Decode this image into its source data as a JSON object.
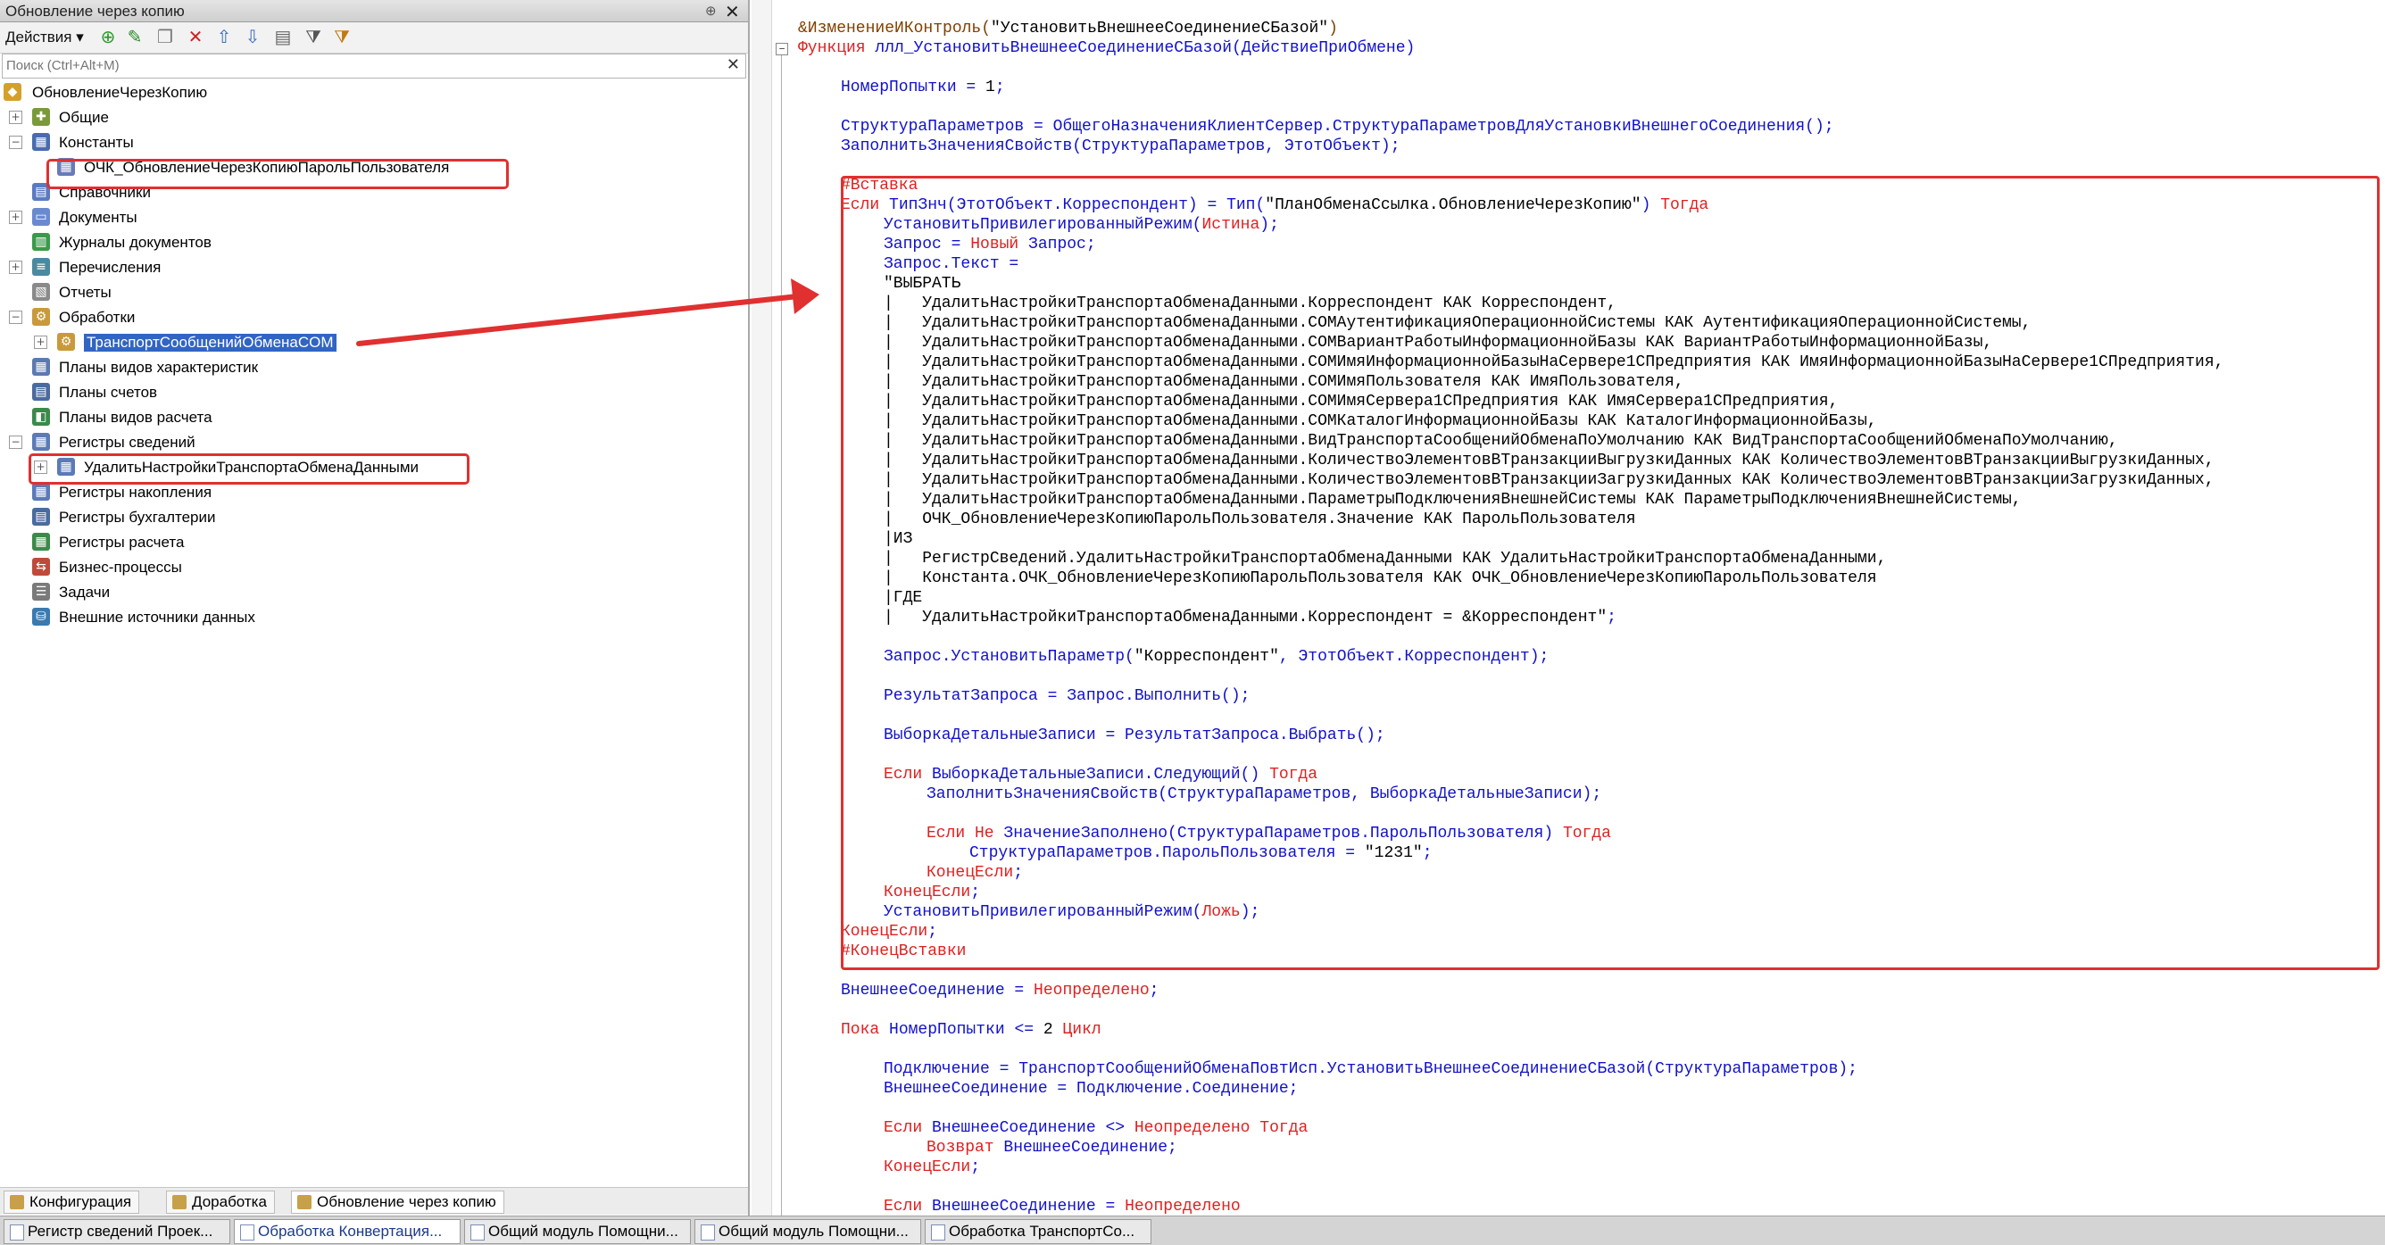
{
  "left_panel": {
    "title": "Обновление через копию",
    "pin": "⊕",
    "close": "✕",
    "actions_label": "Действия ▾",
    "search_placeholder": "Поиск (Ctrl+Alt+M)",
    "tree": [
      {
        "label": "ОбновлениеЧерезКопию",
        "level": 0,
        "icon": "config-icon",
        "expander": "",
        "color": "#d4a02a"
      },
      {
        "label": "Общие",
        "level": 1,
        "icon": "common-icon",
        "expander": "+",
        "color": "#7a9a3a"
      },
      {
        "label": "Константы",
        "level": 1,
        "icon": "constants-icon",
        "expander": "−",
        "color": "#4a6ab0"
      },
      {
        "label": "ОЧК_ОбновлениеЧерезКопиюПарольПользователя",
        "level": 2,
        "icon": "constant-icon",
        "expander": "",
        "color": "#6a7ab8",
        "highlight": true
      },
      {
        "label": "Справочники",
        "level": 1,
        "icon": "catalogs-icon",
        "expander": "",
        "color": "#5a7ac0"
      },
      {
        "label": "Документы",
        "level": 1,
        "icon": "documents-icon",
        "expander": "+",
        "color": "#6a8ad0"
      },
      {
        "label": "Журналы документов",
        "level": 1,
        "icon": "journals-icon",
        "expander": "",
        "color": "#3a9a4a"
      },
      {
        "label": "Перечисления",
        "level": 1,
        "icon": "enums-icon",
        "expander": "+",
        "color": "#4a8aa0"
      },
      {
        "label": "Отчеты",
        "level": 1,
        "icon": "reports-icon",
        "expander": "",
        "color": "#8a8a8a"
      },
      {
        "label": "Обработки",
        "level": 1,
        "icon": "dataprocessors-icon",
        "expander": "−",
        "color": "#c89a3a"
      },
      {
        "label": "ТранспортСообщенийОбменаCOM",
        "level": 2,
        "icon": "dataprocessor-icon",
        "expander": "+",
        "color": "#c89a3a",
        "selected": true
      },
      {
        "label": "Планы видов характеристик",
        "level": 1,
        "icon": "chartofchar-icon",
        "expander": "",
        "color": "#5a7ab0"
      },
      {
        "label": "Планы счетов",
        "level": 1,
        "icon": "chartofaccounts-icon",
        "expander": "",
        "color": "#4a6aa0"
      },
      {
        "label": "Планы видов расчета",
        "level": 1,
        "icon": "chartofcalc-icon",
        "expander": "",
        "color": "#3a8a4a"
      },
      {
        "label": "Регистры сведений",
        "level": 1,
        "icon": "inforegisters-icon",
        "expander": "−",
        "color": "#5a7ab8"
      },
      {
        "label": "УдалитьНастройкиТранспортаОбменаДанными",
        "level": 2,
        "icon": "inforegister-icon",
        "expander": "+",
        "color": "#5a7ab8",
        "highlight": true
      },
      {
        "label": "Регистры накопления",
        "level": 1,
        "icon": "accumregisters-icon",
        "expander": "",
        "color": "#5a7ab8"
      },
      {
        "label": "Регистры бухгалтерии",
        "level": 1,
        "icon": "accountingregisters-icon",
        "expander": "",
        "color": "#4a6aa0"
      },
      {
        "label": "Регистры расчета",
        "level": 1,
        "icon": "calcregisters-icon",
        "expander": "",
        "color": "#3a8a4a"
      },
      {
        "label": "Бизнес-процессы",
        "level": 1,
        "icon": "bizprocess-icon",
        "expander": "",
        "color": "#c04a3a"
      },
      {
        "label": "Задачи",
        "level": 1,
        "icon": "tasks-icon",
        "expander": "",
        "color": "#7a7a7a"
      },
      {
        "label": "Внешние источники данных",
        "level": 1,
        "icon": "extsources-icon",
        "expander": "",
        "color": "#3a7ab0"
      }
    ],
    "tabs": [
      "Конфигурация",
      "Доработка",
      "Обновление через копию"
    ]
  },
  "taskbar": [
    {
      "label": "Регистр сведений Проек...",
      "active": false
    },
    {
      "label": "Обработка Конвертация...",
      "active": true
    },
    {
      "label": "Общий модуль Помощни...",
      "active": false
    },
    {
      "label": "Общий модуль Помощни...",
      "active": false
    },
    {
      "label": "Обработка ТранспортСо...",
      "active": false
    }
  ],
  "code_lines": [
    {
      "indent": 0,
      "html": "<span class='dir'>&amp;ИзменениеИКонтроль(</span><span class='str'>\"УстановитьВнешнееСоединениеСБазой\"</span><span class='dir'>)</span>"
    },
    {
      "indent": 0,
      "html": "<span class='kw'>Функция</span> ллл_УстановитьВнешнееСоединениеСБазой(ДействиеПриОбмене)"
    },
    {
      "indent": 0,
      "html": ""
    },
    {
      "indent": 1,
      "html": "НомерПопытки = <span class='blk'>1</span>;"
    },
    {
      "indent": 0,
      "html": ""
    },
    {
      "indent": 1,
      "html": "СтруктураПараметров = ОбщегоНазначенияКлиентСервер.СтруктураПараметровДляУстановкиВнешнегоСоединения();"
    },
    {
      "indent": 1,
      "html": "ЗаполнитьЗначенияСвойств(СтруктураПараметров, ЭтотОбъект);"
    },
    {
      "indent": 0,
      "html": ""
    },
    {
      "indent": 1,
      "html": "<span class='kw'>#Вставка</span>"
    },
    {
      "indent": 1,
      "html": "<span class='kw'>Если</span> ТипЗнч(ЭтотОбъект.Корреспондент) = Тип(<span class='str'>\"ПланОбменаСсылка.ОбновлениеЧерезКопию\"</span>) <span class='kw'>Тогда</span>"
    },
    {
      "indent": 2,
      "html": "УстановитьПривилегированныйРежим(<span class='kw'>Истина</span>);"
    },
    {
      "indent": 2,
      "html": "Запрос = <span class='kw'>Новый</span> Запрос;"
    },
    {
      "indent": 2,
      "html": "Запрос.Текст ="
    },
    {
      "indent": 2,
      "html": "<span class='str'>\"ВЫБРАТЬ</span>"
    },
    {
      "indent": 2,
      "html": "<span class='str'>|   УдалитьНастройкиТранспортаОбменаДанными.Корреспондент КАК Корреспондент,</span>"
    },
    {
      "indent": 2,
      "html": "<span class='str'>|   УдалитьНастройкиТранспортаОбменаДанными.COMАутентификацияОперационнойСистемы КАК АутентификацияОперационнойСистемы,</span>"
    },
    {
      "indent": 2,
      "html": "<span class='str'>|   УдалитьНастройкиТранспортаОбменаДанными.COMВариантРаботыИнформационнойБазы КАК ВариантРаботыИнформационнойБазы,</span>"
    },
    {
      "indent": 2,
      "html": "<span class='str'>|   УдалитьНастройкиТранспортаОбменаДанными.COMИмяИнформационнойБазыНаСервере1СПредприятия КАК ИмяИнформационнойБазыНаСервере1СПредприятия,</span>"
    },
    {
      "indent": 2,
      "html": "<span class='str'>|   УдалитьНастройкиТранспортаОбменаДанными.COMИмяПользователя КАК ИмяПользователя,</span>"
    },
    {
      "indent": 2,
      "html": "<span class='str'>|   УдалитьНастройкиТранспортаОбменаДанными.COMИмяСервера1СПредприятия КАК ИмяСервера1СПредприятия,</span>"
    },
    {
      "indent": 2,
      "html": "<span class='str'>|   УдалитьНастройкиТранспортаОбменаДанными.COMКаталогИнформационнойБазы КАК КаталогИнформационнойБазы,</span>"
    },
    {
      "indent": 2,
      "html": "<span class='str'>|   УдалитьНастройкиТранспортаОбменаДанными.ВидТранспортаСообщенийОбменаПоУмолчанию КАК ВидТранспортаСообщенийОбменаПоУмолчанию,</span>"
    },
    {
      "indent": 2,
      "html": "<span class='str'>|   УдалитьНастройкиТранспортаОбменаДанными.КоличествоЭлементовВТранзакцииВыгрузкиДанных КАК КоличествоЭлементовВТранзакцииВыгрузкиДанных,</span>"
    },
    {
      "indent": 2,
      "html": "<span class='str'>|   УдалитьНастройкиТранспортаОбменаДанными.КоличествоЭлементовВТранзакцииЗагрузкиДанных КАК КоличествоЭлементовВТранзакцииЗагрузкиДанных,</span>"
    },
    {
      "indent": 2,
      "html": "<span class='str'>|   УдалитьНастройкиТранспортаОбменаДанными.ПараметрыПодключенияВнешнейСистемы КАК ПараметрыПодключенияВнешнейСистемы,</span>"
    },
    {
      "indent": 2,
      "html": "<span class='str'>|   ОЧК_ОбновлениеЧерезКопиюПарольПользователя.Значение КАК ПарольПользователя</span>"
    },
    {
      "indent": 2,
      "html": "<span class='str'>|ИЗ</span>"
    },
    {
      "indent": 2,
      "html": "<span class='str'>|   РегистрСведений.УдалитьНастройкиТранспортаОбменаДанными КАК УдалитьНастройкиТранспортаОбменаДанными,</span>"
    },
    {
      "indent": 2,
      "html": "<span class='str'>|   Константа.ОЧК_ОбновлениеЧерезКопиюПарольПользователя КАК ОЧК_ОбновлениеЧерезКопиюПарольПользователя</span>"
    },
    {
      "indent": 2,
      "html": "<span class='str'>|ГДЕ</span>"
    },
    {
      "indent": 2,
      "html": "<span class='str'>|   УдалитьНастройкиТранспортаОбменаДанными.Корреспондент = &amp;Корреспондент\"</span>;"
    },
    {
      "indent": 0,
      "html": ""
    },
    {
      "indent": 2,
      "html": "Запрос.УстановитьПараметр(<span class='str'>\"Корреспондент\"</span>, ЭтотОбъект.Корреспондент);"
    },
    {
      "indent": 0,
      "html": ""
    },
    {
      "indent": 2,
      "html": "РезультатЗапроса = Запрос.Выполнить();"
    },
    {
      "indent": 0,
      "html": ""
    },
    {
      "indent": 2,
      "html": "ВыборкаДетальныеЗаписи = РезультатЗапроса.Выбрать();"
    },
    {
      "indent": 0,
      "html": ""
    },
    {
      "indent": 2,
      "html": "<span class='kw'>Если</span> ВыборкаДетальныеЗаписи.Следующий() <span class='kw'>Тогда</span>"
    },
    {
      "indent": 3,
      "html": "ЗаполнитьЗначенияСвойств(СтруктураПараметров, ВыборкаДетальныеЗаписи);"
    },
    {
      "indent": 0,
      "html": ""
    },
    {
      "indent": 3,
      "html": "<span class='kw'>Если Не</span> ЗначениеЗаполнено(СтруктураПараметров.ПарольПользователя) <span class='kw'>Тогда</span>"
    },
    {
      "indent": 4,
      "html": "СтруктураПараметров.ПарольПользователя = <span class='str'>\"1231\"</span>;"
    },
    {
      "indent": 3,
      "html": "<span class='kw'>КонецЕсли</span>;"
    },
    {
      "indent": 2,
      "html": "<span class='kw'>КонецЕсли</span>;"
    },
    {
      "indent": 2,
      "html": "УстановитьПривилегированныйРежим(<span class='kw'>Ложь</span>);"
    },
    {
      "indent": 1,
      "html": "<span class='kw'>КонецЕсли</span>;"
    },
    {
      "indent": 1,
      "html": "<span class='kw'>#КонецВставки</span>"
    },
    {
      "indent": 0,
      "html": ""
    },
    {
      "indent": 1,
      "html": "ВнешнееСоединение = <span class='kw'>Неопределено</span>;"
    },
    {
      "indent": 0,
      "html": ""
    },
    {
      "indent": 1,
      "html": "<span class='kw'>Пока</span> НомерПопытки &lt;= <span class='blk'>2</span> <span class='kw'>Цикл</span>"
    },
    {
      "indent": 0,
      "html": ""
    },
    {
      "indent": 2,
      "html": "Подключение = ТранспортСообщенийОбменаПовтИсп.УстановитьВнешнееСоединениеСБазой(СтруктураПараметров);"
    },
    {
      "indent": 2,
      "html": "ВнешнееСоединение = Подключение.Соединение;"
    },
    {
      "indent": 0,
      "html": ""
    },
    {
      "indent": 2,
      "html": "<span class='kw'>Если</span> ВнешнееСоединение &lt;&gt; <span class='kw'>Неопределено Тогда</span>"
    },
    {
      "indent": 3,
      "html": "<span class='kw'>Возврат</span> ВнешнееСоединение;"
    },
    {
      "indent": 2,
      "html": "<span class='kw'>КонецЕсли</span>;"
    },
    {
      "indent": 0,
      "html": ""
    },
    {
      "indent": 2,
      "html": "<span class='kw'>Если</span> ВнешнееСоединение = <span class='kw'>Неопределено</span>"
    }
  ]
}
